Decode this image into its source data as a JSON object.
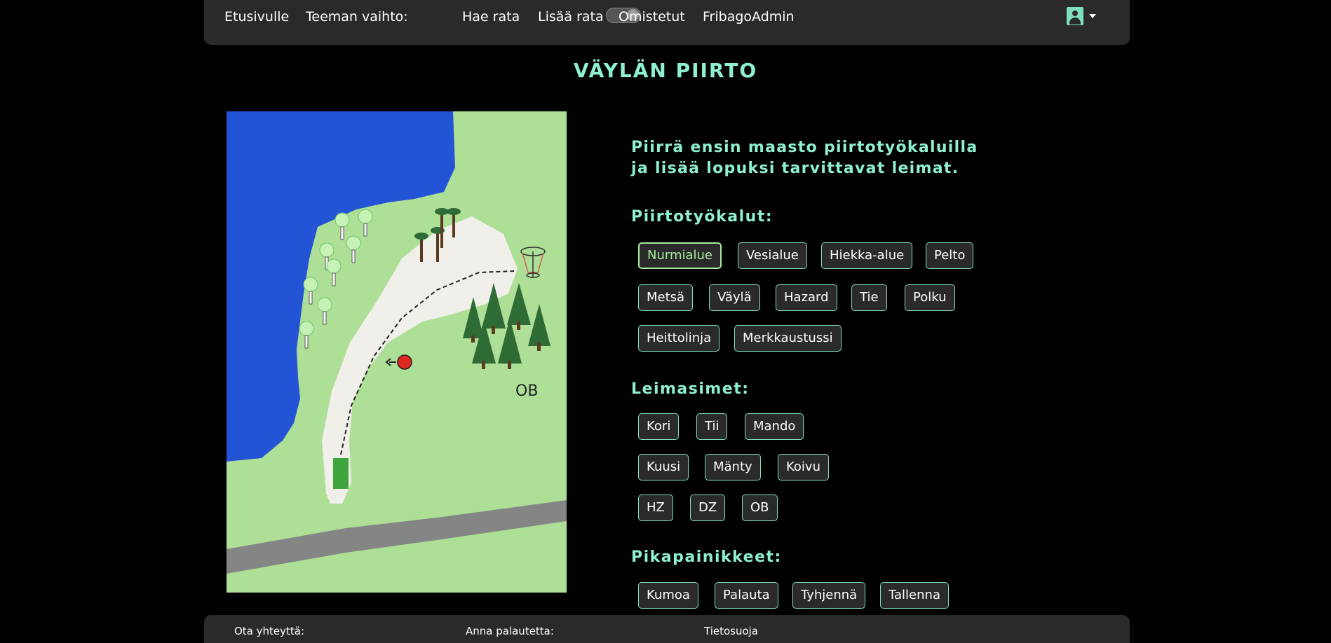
{
  "nav": {
    "home": "Etusivulle",
    "theme_label": "Teeman vaihto:",
    "search_course": "Hae rata",
    "add_course": "Lisää rata",
    "owned": "Omistetut",
    "admin": "FribagoAdmin"
  },
  "page": {
    "title": "VÄYLÄN PIIRTO",
    "instructions": "Piirrä ensin maasto piirtotyökaluilla ja lisää lopuksi tarvittavat leimat."
  },
  "map": {
    "ob_label": "OB"
  },
  "tools": {
    "heading": "Piirtotyökalut:",
    "items": [
      "Nurmialue",
      "Vesialue",
      "Hiekka-alue",
      "Pelto",
      "Metsä",
      "Väylä",
      "Hazard",
      "Tie",
      "Polku",
      "Heittolinja",
      "Merkkaustussi"
    ],
    "active": "Nurmialue"
  },
  "stamps": {
    "heading": "Leimasimet:",
    "items": [
      "Kori",
      "Tii",
      "Mando",
      "Kuusi",
      "Mänty",
      "Koivu",
      "HZ",
      "DZ",
      "OB"
    ]
  },
  "quick": {
    "heading": "Pikapainikkeet:",
    "items": [
      "Kumoa",
      "Palauta",
      "Tyhjennä",
      "Tallenna"
    ]
  },
  "footer": {
    "contact": "Ota yhteyttä:",
    "feedback": "Anna palautetta:",
    "privacy": "Tietosuoja"
  },
  "colors": {
    "accent": "#8ff0cf",
    "button_border": "#7fe0c0",
    "active_button": "#a9e9a0",
    "grass": "#addf97",
    "water": "#2454d6",
    "fairway": "#f1efe9",
    "road": "#858585",
    "forest": "#2e6b35",
    "tee": "#3ea53d",
    "mando": "#e0271f"
  }
}
